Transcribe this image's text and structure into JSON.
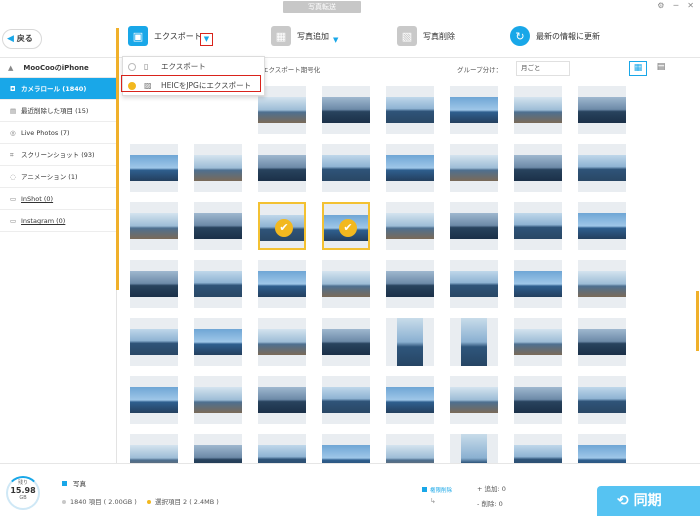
{
  "window": {
    "title": "写真転送"
  },
  "toolbar": {
    "back_label": "戻る",
    "export_label": "エクスポート",
    "add_label": "写真追加",
    "delete_label": "写真削除",
    "refresh_label": "最新の情報に更新"
  },
  "export_menu": {
    "items": [
      {
        "label": "エクスポート",
        "selected": false
      },
      {
        "label": "HEICをJPGにエクスポート",
        "selected": true
      }
    ]
  },
  "sidebar": {
    "device": "MooCooのiPhone",
    "items": [
      {
        "label": "カメラロール (1840)",
        "icon": "camera-icon",
        "active": true
      },
      {
        "label": "最近削除した項目 (15)",
        "icon": "trash-icon",
        "active": false
      },
      {
        "label": "Live Photos (7)",
        "icon": "live-icon",
        "active": false
      },
      {
        "label": "スクリーンショット (93)",
        "icon": "screenshot-icon",
        "active": false
      },
      {
        "label": "アニメーション (1)",
        "icon": "animation-icon",
        "active": false
      },
      {
        "label": "InShot (0)",
        "icon": "album-icon",
        "active": false
      },
      {
        "label": "Instagram (0)",
        "icon": "album-icon",
        "active": false
      }
    ]
  },
  "filterbar": {
    "label": "エクスポート期号化",
    "group_label": "グループ分け：",
    "group_value": "月ごと"
  },
  "footer": {
    "storage_label": "残り",
    "storage_value": "15.98",
    "storage_unit": "GB",
    "type": "写真",
    "items_total": "1840 項目 ( 2.00GB )",
    "items_selected": "選択項目 2 ( 2.4MB )",
    "permission": "権限削除",
    "added": "+ 追加: 0",
    "deleted": "- 削除: 0",
    "sync_label": "同期"
  },
  "colors": {
    "accent": "#19a7e8",
    "selection": "#f2b81f",
    "highlight": "#d9231b"
  }
}
